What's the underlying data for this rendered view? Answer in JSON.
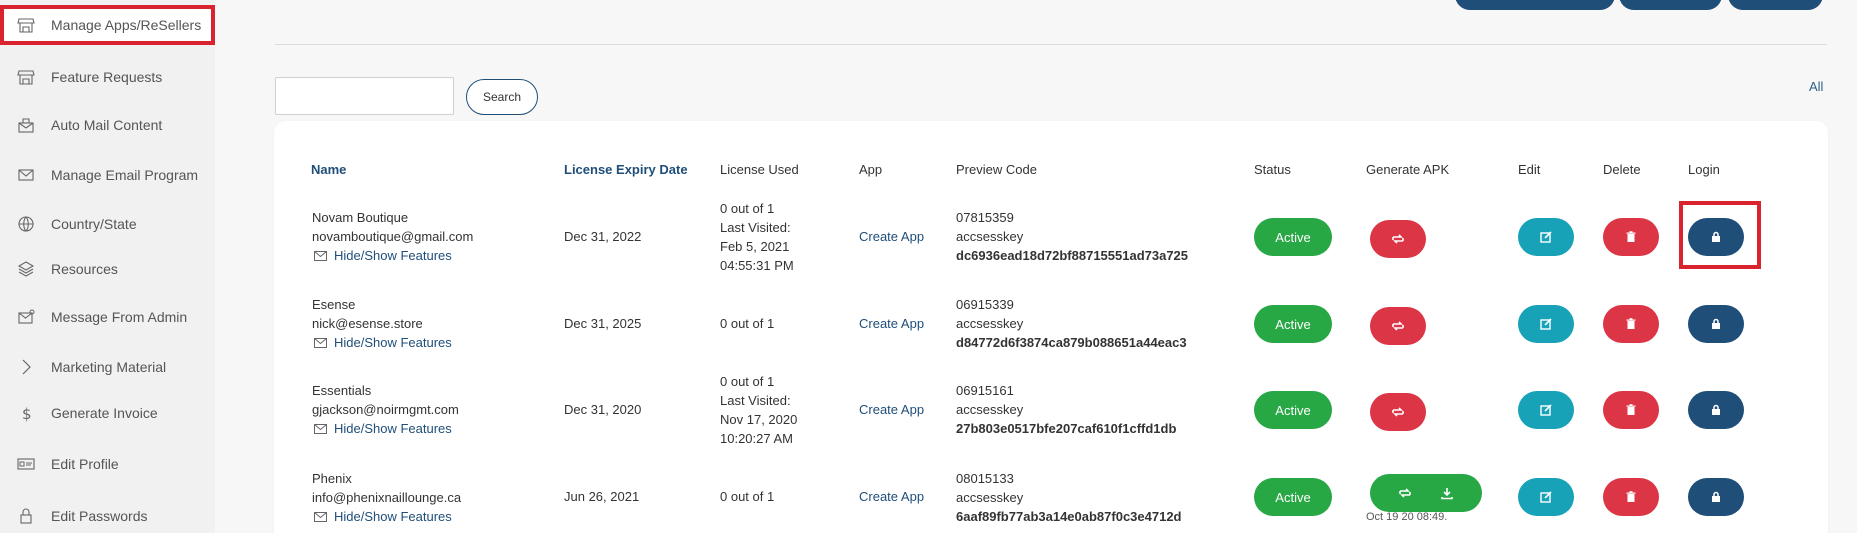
{
  "sidebar": {
    "items": [
      {
        "label": "Manage Apps/ReSellers",
        "icon": "store-icon"
      },
      {
        "label": "Feature Requests",
        "icon": "store-icon"
      },
      {
        "label": "Auto Mail Content",
        "icon": "mail-auto-icon"
      },
      {
        "label": "Manage Email Program",
        "icon": "envelope-icon"
      },
      {
        "label": "Country/State",
        "icon": "globe-icon"
      },
      {
        "label": "Resources",
        "icon": "layers-icon"
      },
      {
        "label": "Message From Admin",
        "icon": "mail-admin-icon"
      },
      {
        "label": "Marketing Material",
        "icon": "chevron-right-icon"
      },
      {
        "label": "Generate Invoice",
        "icon": "dollar-icon"
      },
      {
        "label": "Edit Profile",
        "icon": "id-card-icon"
      },
      {
        "label": "Edit Passwords",
        "icon": "lock-icon"
      }
    ]
  },
  "search": {
    "placeholder": "",
    "value": "",
    "button_label": "Search"
  },
  "all_link": "All",
  "table": {
    "headers": {
      "name": "Name",
      "expiry": "License Expiry Date",
      "used": "License Used",
      "app": "App",
      "preview": "Preview Code",
      "status": "Status",
      "apk": "Generate APK",
      "edit": "Edit",
      "delete": "Delete",
      "login": "Login"
    },
    "rows": [
      {
        "name": "Novam Boutique",
        "email": "novamboutique@gmail.com",
        "features": "Hide/Show Features",
        "expiry": "Dec 31, 2022",
        "used": [
          "0 out of 1",
          "Last Visited:",
          "Feb 5, 2021",
          "04:55:31 PM"
        ],
        "app": "Create App",
        "preview": [
          "07815359",
          "accsesskey",
          "dc6936ead18d72bf88715551ad73a725"
        ],
        "status": "Active"
      },
      {
        "name": "Esense",
        "email": "nick@esense.store",
        "features": "Hide/Show Features",
        "expiry": "Dec 31, 2025",
        "used": [
          "0 out of 1"
        ],
        "app": "Create App",
        "preview": [
          "06915339",
          "accsesskey",
          "d84772d6f3874ca879b088651a44eac3"
        ],
        "status": "Active"
      },
      {
        "name": "Essentials",
        "email": "gjackson@noirmgmt.com",
        "features": "Hide/Show Features",
        "expiry": "Dec 31, 2020",
        "used": [
          "0 out of 1",
          "Last Visited:",
          "Nov 17, 2020",
          "10:20:27 AM"
        ],
        "app": "Create App",
        "preview": [
          "06915161",
          "accsesskey",
          "27b803e0517bfe207caf610f1cffd1db"
        ],
        "status": "Active"
      },
      {
        "name": "Phenix",
        "email": "info@phenixnaillounge.ca",
        "features": "Hide/Show Features",
        "expiry": "Jun 26, 2021",
        "used": [
          "0 out of 1"
        ],
        "app": "Create App",
        "preview": [
          "08015133",
          "accsesskey",
          "6aaf89fb77ab3a14e0ab87f0c3e4712d"
        ],
        "status": "Active",
        "apk_time": "Oct 19 20 08:49."
      }
    ]
  },
  "colors": {
    "primary": "#1f4e79",
    "success": "#28a745",
    "danger": "#dc3545",
    "info": "#17a2b8",
    "highlight": "#d9232e"
  }
}
